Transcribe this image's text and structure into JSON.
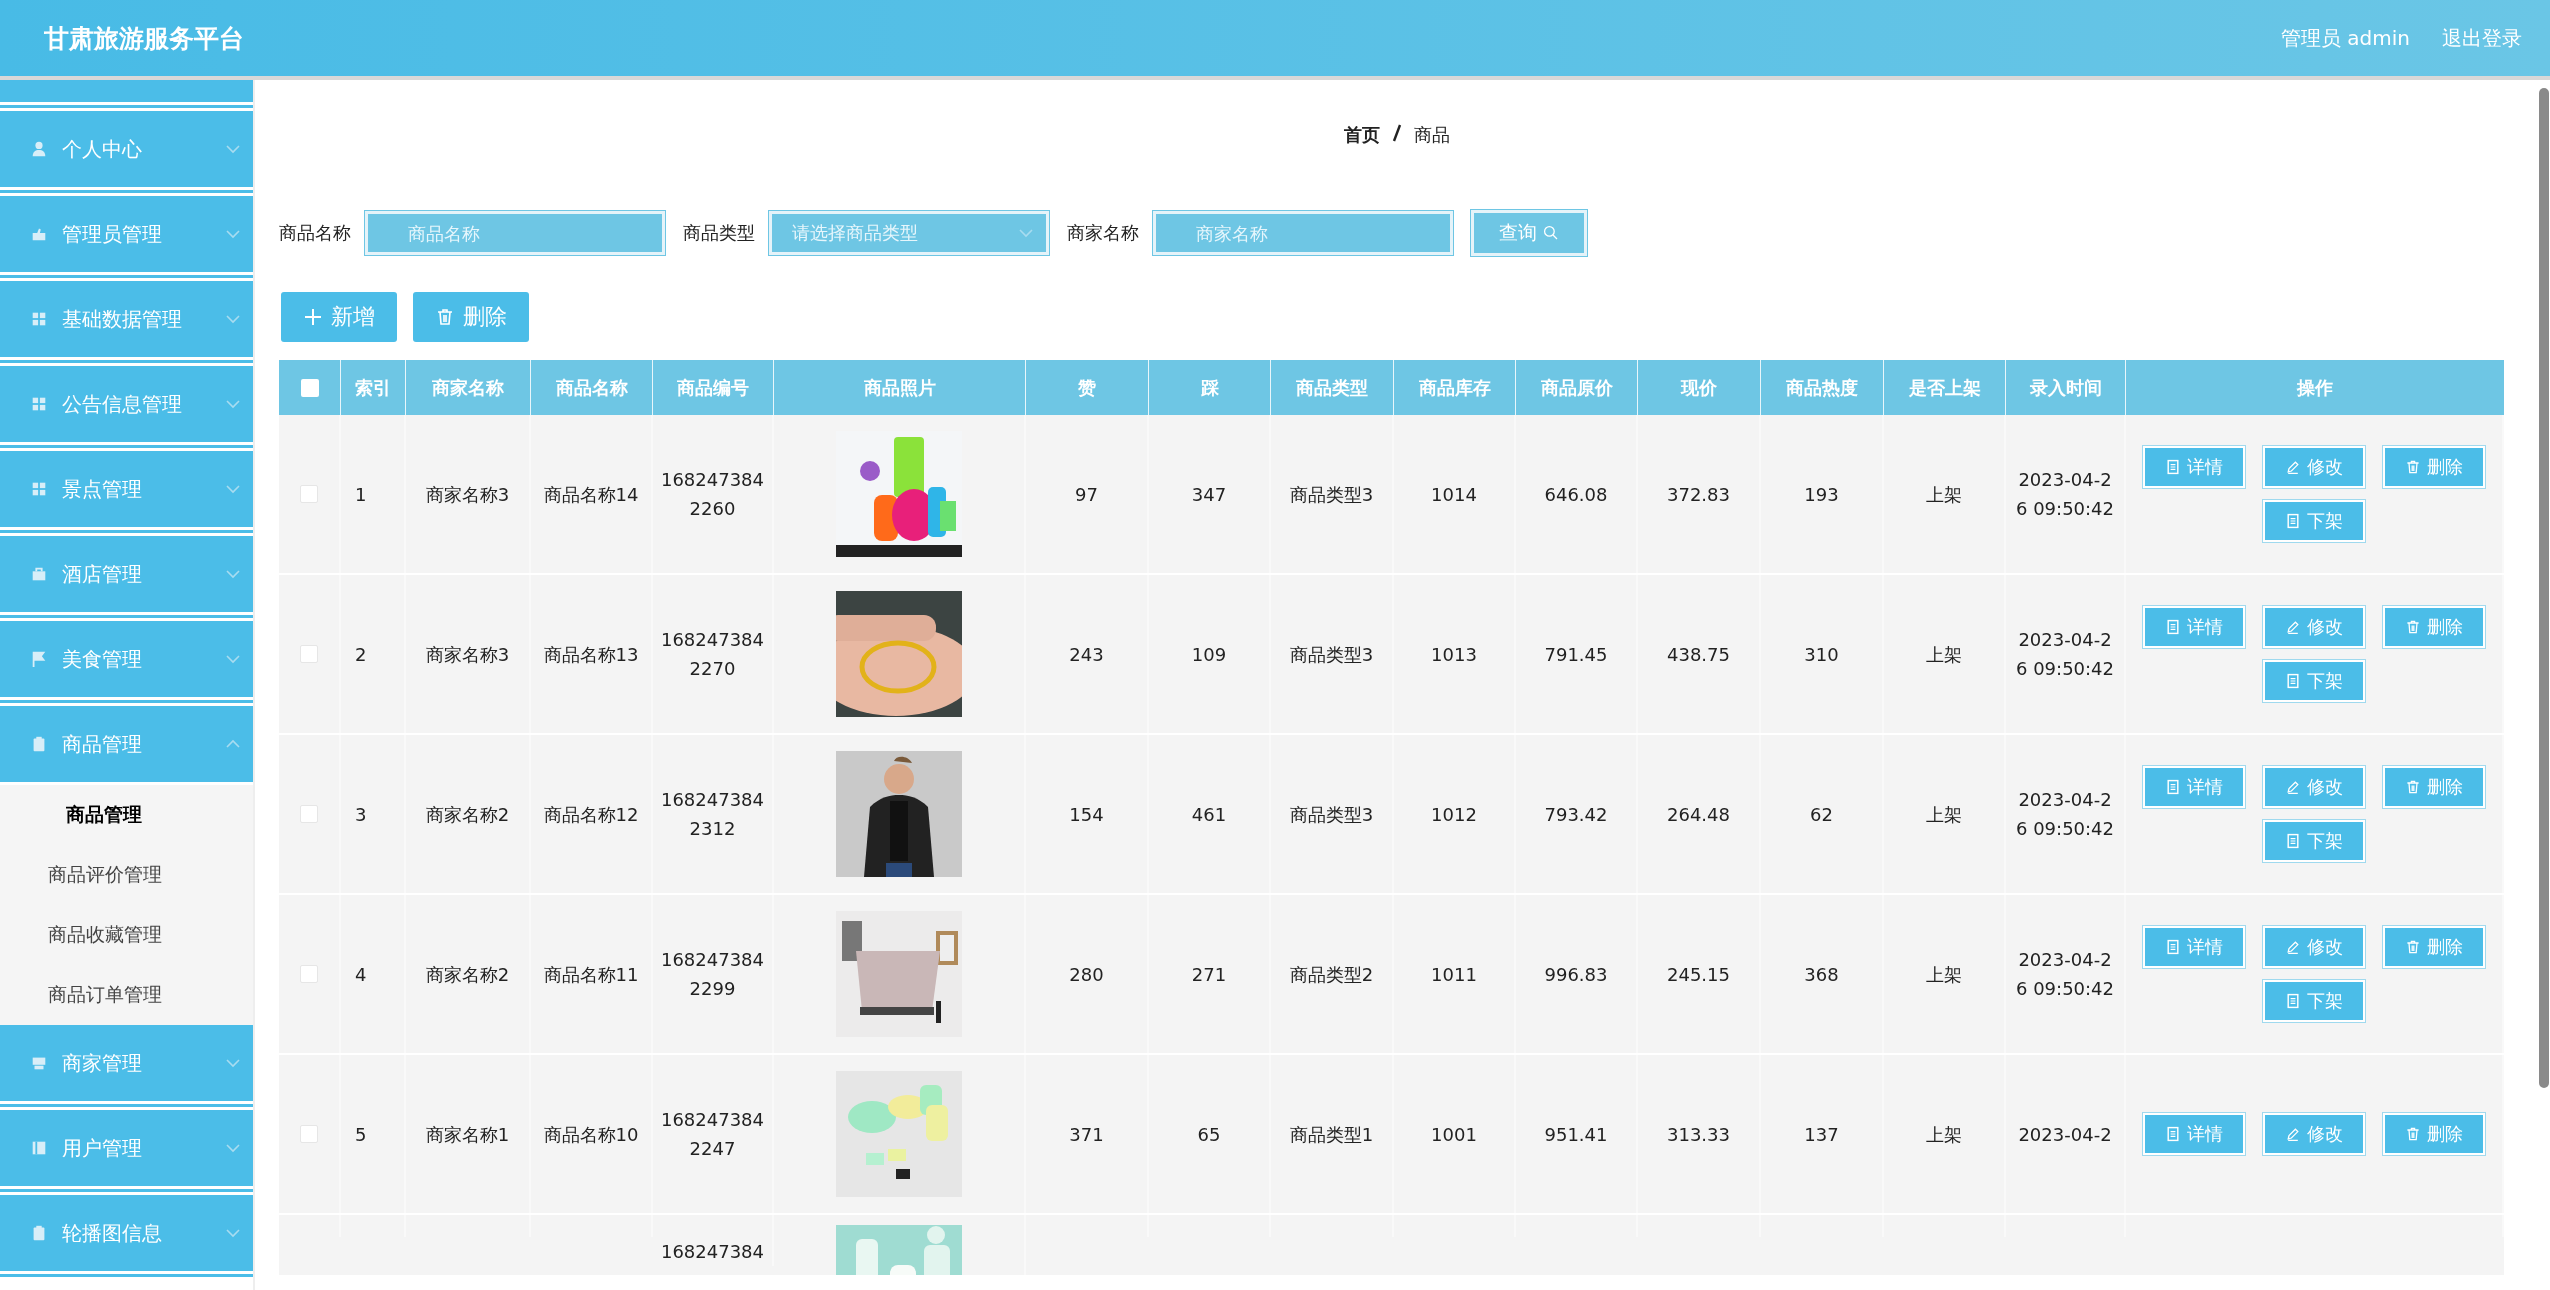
{
  "header": {
    "title": "甘肃旅游服务平台",
    "user": "管理员 admin",
    "logout": "退出登录"
  },
  "sidebar": {
    "items": [
      {
        "label": "个人中心",
        "expanded": false
      },
      {
        "label": "管理员管理",
        "expanded": false
      },
      {
        "label": "基础数据管理",
        "expanded": false
      },
      {
        "label": "公告信息管理",
        "expanded": false
      },
      {
        "label": "景点管理",
        "expanded": false
      },
      {
        "label": "酒店管理",
        "expanded": false
      },
      {
        "label": "美食管理",
        "expanded": false
      },
      {
        "label": "商品管理",
        "expanded": true,
        "children": [
          {
            "label": "商品管理",
            "selected": true
          },
          {
            "label": "商品评价管理",
            "selected": false
          },
          {
            "label": "商品收藏管理",
            "selected": false
          },
          {
            "label": "商品订单管理",
            "selected": false
          }
        ]
      },
      {
        "label": "商家管理",
        "expanded": false
      },
      {
        "label": "用户管理",
        "expanded": false
      },
      {
        "label": "轮播图信息",
        "expanded": false
      }
    ]
  },
  "breadcrumb": [
    "首页",
    "商品"
  ],
  "search": {
    "fields": [
      {
        "label": "商品名称",
        "kind": "input",
        "placeholder": "商品名称"
      },
      {
        "label": "商品类型",
        "kind": "select",
        "placeholder": "请选择商品类型"
      },
      {
        "label": "商家名称",
        "kind": "input",
        "placeholder": "商家名称"
      }
    ],
    "button": "查询"
  },
  "actions": [
    "新增",
    "删除"
  ],
  "table": {
    "header_checked": false,
    "columns": [
      "索引",
      "商家名称",
      "商品名称",
      "商品编号",
      "商品照片",
      "赞",
      "踩",
      "商品类型",
      "商品库存",
      "商品原价",
      "现价",
      "商品热度",
      "是否上架",
      "录入时间",
      "操作"
    ],
    "rows": [
      {
        "checked": false,
        "cells": [
          "1",
          "商家名称3",
          "商品名称14",
          "168247384 2260",
          {
            "kind": "picture"
          },
          "97",
          "347",
          "商品类型3",
          "1014",
          "646.08",
          "372.83",
          "193",
          "上架",
          "2023-04-2 6 09:50:42"
        ],
        "buttons": [
          "详情",
          "修改",
          "删除",
          "下架"
        ]
      },
      {
        "checked": false,
        "cells": [
          "2",
          "商家名称3",
          "商品名称13",
          "168247384 2270",
          {
            "kind": "picture"
          },
          "243",
          "109",
          "商品类型3",
          "1013",
          "791.45",
          "438.75",
          "310",
          "上架",
          "2023-04-2 6 09:50:42"
        ],
        "buttons": [
          "详情",
          "修改",
          "删除",
          "下架"
        ]
      },
      {
        "checked": false,
        "cells": [
          "3",
          "商家名称2",
          "商品名称12",
          "168247384 2312",
          {
            "kind": "picture"
          },
          "154",
          "461",
          "商品类型3",
          "1012",
          "793.42",
          "264.48",
          "62",
          "上架",
          "2023-04-2 6 09:50:42"
        ],
        "buttons": [
          "详情",
          "修改",
          "删除",
          "下架"
        ]
      },
      {
        "checked": false,
        "cells": [
          "4",
          "商家名称2",
          "商品名称11",
          "168247384 2299",
          {
            "kind": "picture"
          },
          "280",
          "271",
          "商品类型2",
          "1011",
          "996.83",
          "245.15",
          "368",
          "上架",
          "2023-04-2 6 09:50:42"
        ],
        "buttons": [
          "详情",
          "修改",
          "删除",
          "下架"
        ]
      },
      {
        "checked": false,
        "cells": [
          "5",
          "商家名称1",
          "商品名称10",
          "168247384 2247",
          {
            "kind": "picture"
          },
          "371",
          "65",
          "商品类型1",
          "1001",
          "951.41",
          "313.33",
          "137",
          "上架",
          "2023-04-2"
        ],
        "buttons": [
          "详情",
          "修改",
          "删除"
        ]
      }
    ],
    "partial_row": {
      "code": "168247384",
      "photo": {
        "kind": "picture"
      }
    }
  }
}
